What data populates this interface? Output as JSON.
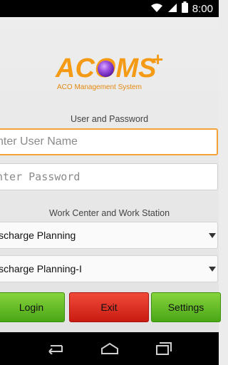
{
  "status_bar": {
    "time": "8:00",
    "icons": [
      "wifi-icon",
      "signal-icon",
      "battery-icon"
    ]
  },
  "logo": {
    "name": "ACOMS",
    "plus": "+",
    "tagline": "ACO Management System"
  },
  "credentials": {
    "section_label": "User and Password",
    "username_placeholder": "nter User Name",
    "password_placeholder": "nter Password"
  },
  "work": {
    "section_label": "Work Center and Work Station",
    "work_center_selected": "ischarge Planning",
    "work_station_selected": "ischarge Planning-I"
  },
  "buttons": {
    "login": "Login",
    "exit": "Exit",
    "settings": "Settings"
  },
  "colors": {
    "accent_orange": "#f49a14",
    "login_green": "#5cb824",
    "exit_red": "#dd2a1e",
    "focus_border": "#f3a23a"
  },
  "nav_bar": {
    "icons": [
      "back-icon",
      "home-icon",
      "recent-apps-icon"
    ]
  }
}
